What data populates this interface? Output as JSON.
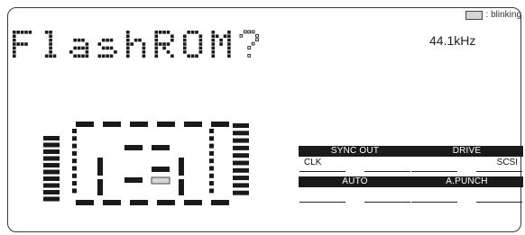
{
  "legend": {
    "label": ": blinking"
  },
  "display": {
    "message": "FlashROM?",
    "sample_rate": "44.1kHz"
  },
  "status": {
    "sync_out": {
      "title": "SYNC OUT",
      "left": "CLK",
      "right": ""
    },
    "drive": {
      "title": "DRIVE",
      "left": "",
      "right": "SCSI"
    },
    "auto": {
      "title": "AUTO",
      "left": "",
      "right": ""
    },
    "a_punch": {
      "title": "A.PUNCH",
      "left": "",
      "right": ""
    }
  },
  "colors": {
    "blink_segment": "#d6d6d6",
    "lcd_ink": "#1a1a1a"
  }
}
